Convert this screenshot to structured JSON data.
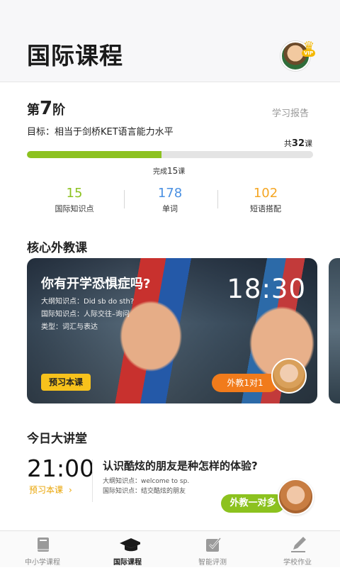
{
  "header": {
    "title": "国际课程",
    "vip_label": "VIP"
  },
  "progress": {
    "stage_prefix": "第",
    "stage_num": "7",
    "stage_suffix": "阶",
    "report_link": "学习报告",
    "goal": "目标：相当于剑桥KET语言能力水平",
    "total_prefix": "共",
    "total_num": "32",
    "total_suffix": "课",
    "done_prefix": "完成",
    "done_num": "15",
    "done_suffix": "课",
    "fraction_complete": 0.47,
    "colors": {
      "fill": "#8cc21f",
      "track": "#e4e4e4"
    }
  },
  "stats": [
    {
      "value": "15",
      "label": "国际知识点",
      "color": "#8cc21f"
    },
    {
      "value": "178",
      "label": "单词",
      "color": "#4a90e2"
    },
    {
      "value": "102",
      "label": "短语搭配",
      "color": "#f5a623"
    }
  ],
  "core": {
    "section_title": "核心外教课",
    "card": {
      "title": "你有开学恐惧症吗?",
      "line1": "大纲知识点：Did sb do sth?",
      "line2": "国际知识点：人际交往–询问",
      "line3": "类型：词汇与表达",
      "time": "18:30",
      "preview_label": "预习本课",
      "tutor_label": "外教1对1"
    }
  },
  "lecture": {
    "section_title": "今日大讲堂",
    "time": "21:00",
    "preview_label": "预习本课",
    "title": "认识酷炫的朋友是种怎样的体验?",
    "line1": "大纲知识点：welcome to sp.",
    "line2": "国际知识点：结交酷炫的朋友",
    "button_label": "外教一对多"
  },
  "tabs": [
    {
      "label": "中小学课程",
      "icon": "book-icon",
      "active": false
    },
    {
      "label": "国际课程",
      "icon": "graduation-cap-icon",
      "active": true
    },
    {
      "label": "智能评测",
      "icon": "checkbox-icon",
      "active": false
    },
    {
      "label": "学校作业",
      "icon": "pencil-icon",
      "active": false
    }
  ]
}
